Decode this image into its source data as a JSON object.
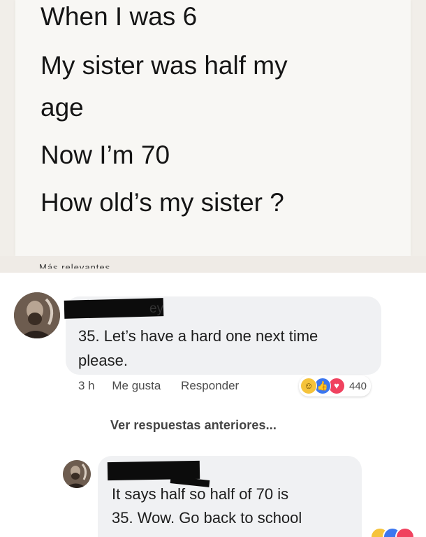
{
  "post": {
    "lines": [
      "When I was 6",
      "My sister was half my",
      "age",
      "Now I’m 70",
      "How old’s my sister ?"
    ]
  },
  "section_cut_label": "Más relevantes",
  "comment1": {
    "name_visible_tail": "ey",
    "text_line1": "35. Let’s have a hard one next time",
    "text_line2": "please.",
    "time": "3 h",
    "like_label": "Me gusta",
    "reply_label": "Responder",
    "reaction_count": "440",
    "reaction_icons": [
      "haha-icon",
      "like-icon",
      "love-icon"
    ]
  },
  "view_previous_replies": "Ver respuestas anteriores...",
  "reply1": {
    "text_line1": "It says half so half of 70 is",
    "text_line2": "35. Wow. Go back to school"
  },
  "colors": {
    "like_blue": "#3b77f0",
    "love_red": "#f0425f",
    "haha_yellow": "#f5c33b",
    "bubble_gray": "#f0f1f3"
  }
}
